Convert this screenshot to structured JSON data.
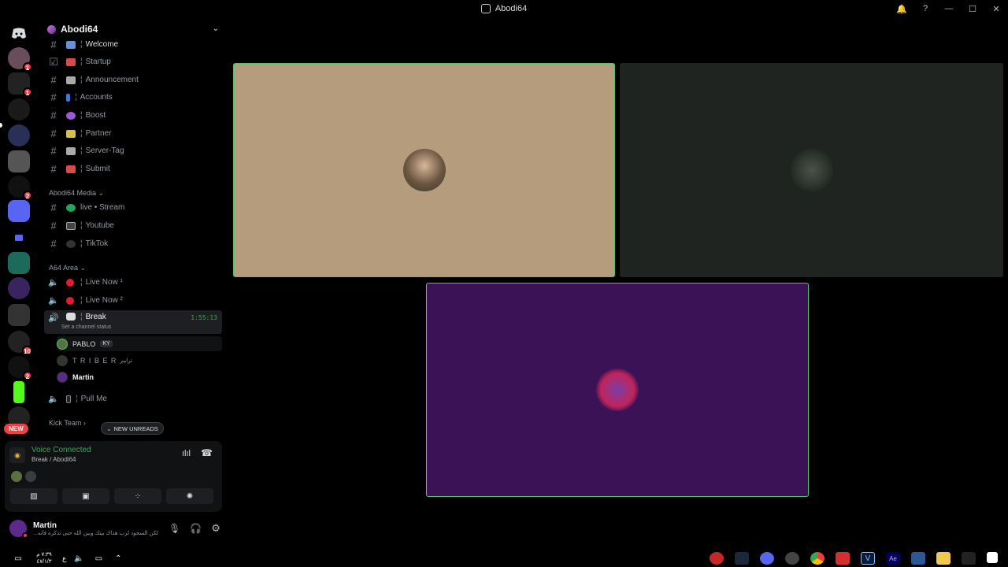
{
  "window": {
    "title": "Abodi64",
    "controls": [
      "🔔",
      "?",
      "—",
      "☐",
      "✕"
    ]
  },
  "rail": {
    "badges": [
      "1",
      "1",
      "2",
      "10",
      "2",
      "NEW"
    ]
  },
  "server": {
    "name": "Abodi64"
  },
  "channels": {
    "top": [
      {
        "label": "Welcome"
      },
      {
        "label": "Startup"
      },
      {
        "label": "Announcement"
      },
      {
        "label": "Accounts"
      },
      {
        "label": "Boost"
      },
      {
        "label": "Partner"
      },
      {
        "label": "Server-Tag"
      },
      {
        "label": "Submit"
      }
    ],
    "media_category": "Abodi64 Media",
    "media": [
      {
        "label": "live • Stream"
      },
      {
        "label": "Youtube"
      },
      {
        "label": "TikTok"
      }
    ],
    "area_category": "A64 Area",
    "area": [
      {
        "label": "Live Now ¹"
      },
      {
        "label": "Live Now ²"
      }
    ],
    "break": {
      "label": "Break",
      "timer": "1:55:13",
      "status_hint": "Set a channel status"
    },
    "break_users": [
      {
        "name": "PABLO",
        "tag": "KY"
      },
      {
        "name": "T R I B E R",
        "tag": "ترايبر"
      },
      {
        "name": "Martin",
        "tag": ""
      }
    ],
    "pull": {
      "label": "Pull Me"
    },
    "kick_category": "Kick Team",
    "new_unreads": "NEW UNREADS"
  },
  "voice": {
    "status": "Voice Connected",
    "location": "Break / Abodi64"
  },
  "user_panel": {
    "name": "Martin",
    "status": "لكن السجود لرب هداك بيتك وبين الله حتى تذكره فانه..."
  },
  "taskbar": {
    "time": "٧:٣٩ م",
    "date": "٤٧/١/٣",
    "lang": "ع"
  },
  "colors": {
    "tile1": "#b59c7d",
    "tile2": "#1f2420",
    "tile3": "#3b1256",
    "speaking": "#4ec36a"
  }
}
